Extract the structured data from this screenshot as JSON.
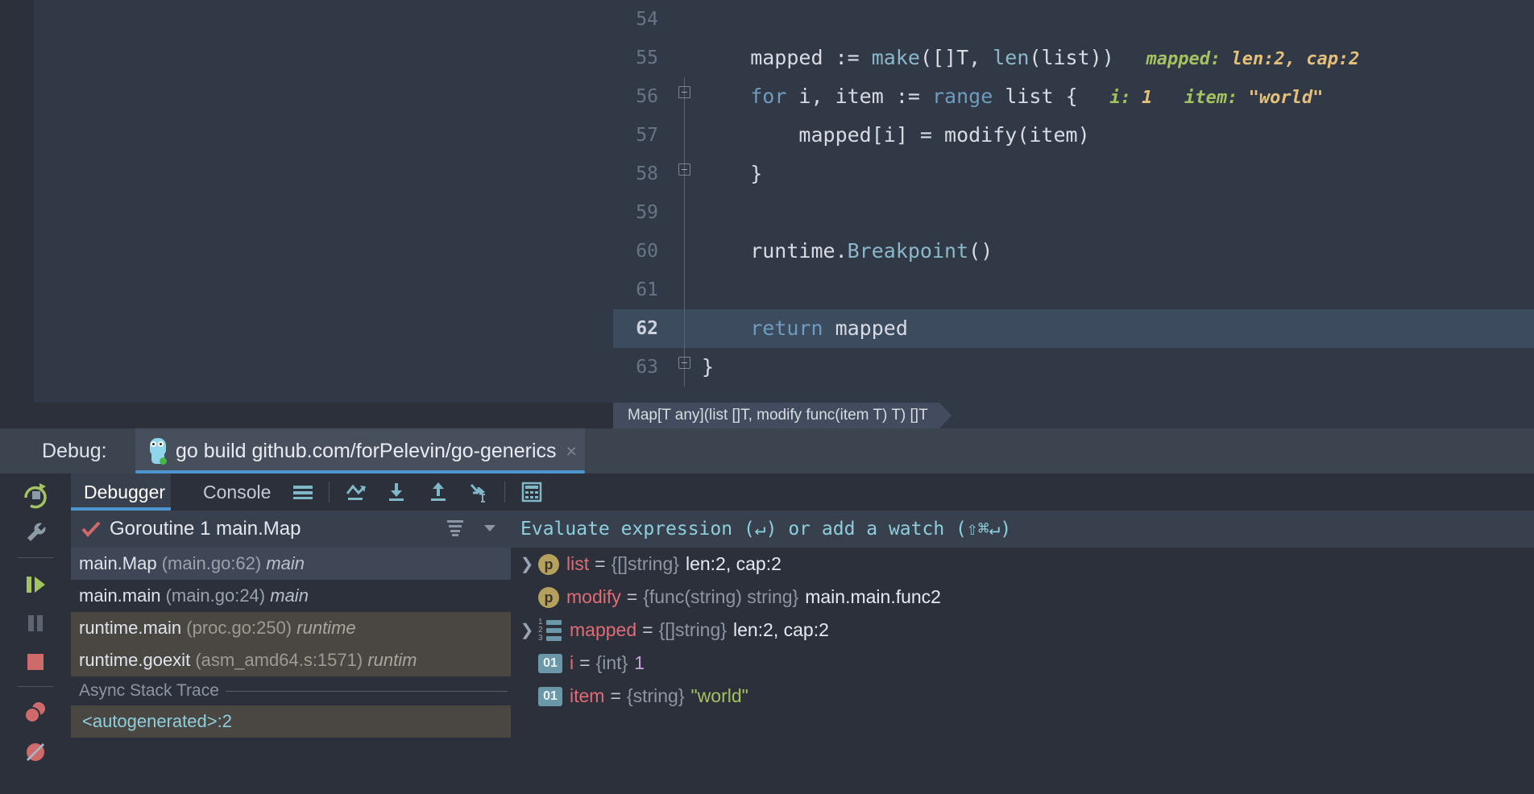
{
  "editor": {
    "lines": [
      {
        "num": "54",
        "text": "",
        "fold": "",
        "current": false,
        "hints": []
      },
      {
        "num": "55",
        "text": "    mapped := make([]T, len(list))",
        "fold": "",
        "current": false,
        "hints": [
          {
            "name": "mapped:",
            "value": "len:2, cap:2"
          }
        ]
      },
      {
        "num": "56",
        "text": "    for i, item := range list {",
        "fold": "start",
        "current": false,
        "hints": [
          {
            "name": "i:",
            "value": "1"
          },
          {
            "name": "item:",
            "value": "\"world\""
          }
        ]
      },
      {
        "num": "57",
        "text": "        mapped[i] = modify(item)",
        "fold": "line",
        "current": false,
        "hints": []
      },
      {
        "num": "58",
        "text": "    }",
        "fold": "end",
        "current": false,
        "hints": []
      },
      {
        "num": "59",
        "text": "",
        "fold": "line",
        "current": false,
        "hints": []
      },
      {
        "num": "60",
        "text": "    runtime.Breakpoint()",
        "fold": "line",
        "current": false,
        "hints": []
      },
      {
        "num": "61",
        "text": "",
        "fold": "line",
        "current": false,
        "hints": []
      },
      {
        "num": "62",
        "text": "    return mapped",
        "fold": "line",
        "current": true,
        "hints": []
      },
      {
        "num": "63",
        "text": "}",
        "fold": "end",
        "current": false,
        "hints": []
      }
    ],
    "breadcrumb": "Map[T any](list []T, modify func(item T) T) []T"
  },
  "debug_header": {
    "label": "Debug:",
    "tab_title": "go build github.com/forPelevin/go-generics",
    "close_icon": "×",
    "run_icon": "go-gopher-icon"
  },
  "gutter_tools": [
    {
      "name": "rerun-icon",
      "title": "Rerun"
    },
    {
      "name": "settings-wrench-icon",
      "title": "Settings"
    },
    {
      "name": "resume-program-icon",
      "title": "Resume Program"
    },
    {
      "name": "pause-program-icon",
      "title": "Pause Program"
    },
    {
      "name": "stop-icon",
      "title": "Stop"
    },
    {
      "name": "view-breakpoints-icon",
      "title": "View Breakpoints"
    },
    {
      "name": "mute-breakpoints-icon",
      "title": "Mute Breakpoints"
    }
  ],
  "toolbar": {
    "tabs": [
      {
        "label": "Debugger",
        "active": true
      },
      {
        "label": "Console",
        "active": false
      }
    ],
    "icons": [
      {
        "name": "layout-settings-icon",
        "title": "Layout Settings"
      },
      {
        "name": "step-over-icon",
        "title": "Step Over"
      },
      {
        "name": "step-into-icon",
        "title": "Step Into"
      },
      {
        "name": "step-out-icon",
        "title": "Step Out"
      },
      {
        "name": "run-to-cursor-icon",
        "title": "Run to Cursor"
      },
      {
        "name": "evaluate-expression-icon",
        "title": "Evaluate Expression"
      }
    ]
  },
  "frames": {
    "thread_title": "Goroutine 1 main.Map",
    "rows": [
      {
        "fn": "main.Map",
        "loc": "(main.go:62)",
        "mod": "main",
        "state": "selected"
      },
      {
        "fn": "main.main",
        "loc": "(main.go:24)",
        "mod": "main",
        "state": "normal"
      },
      {
        "fn": "runtime.main",
        "loc": "(proc.go:250)",
        "mod": "runtime",
        "state": "lib"
      },
      {
        "fn": "runtime.goexit",
        "loc": "(asm_amd64.s:1571)",
        "mod": "runtim",
        "state": "lib"
      }
    ],
    "async_label": "Async Stack Trace",
    "async_rows": [
      "<autogenerated>:2"
    ]
  },
  "variables": {
    "hint": "Evaluate expression (↵) or add a watch (⇧⌘↵)",
    "rows": [
      {
        "expandable": true,
        "badge": "p",
        "name": "list",
        "type": "{[]string}",
        "value": "len:2, cap:2",
        "value_kind": "plain"
      },
      {
        "expandable": false,
        "badge": "p",
        "name": "modify",
        "type": "{func(string) string}",
        "value": "main.main.func2",
        "value_kind": "plain"
      },
      {
        "expandable": true,
        "badge": "arr",
        "name": "mapped",
        "type": "{[]string}",
        "value": "len:2, cap:2",
        "value_kind": "plain"
      },
      {
        "expandable": false,
        "badge": "01",
        "name": "i",
        "type": "{int}",
        "value": "1",
        "value_kind": "num"
      },
      {
        "expandable": false,
        "badge": "01",
        "name": "item",
        "type": "{string}",
        "value": "\"world\"",
        "value_kind": "str"
      }
    ]
  },
  "colors": {
    "background": "#2b303b",
    "editor_bg": "#313846",
    "accent_blue": "#4e94ce",
    "current_line": "#3d4b5e",
    "string_green": "#a5c261",
    "hint_value": "#e5c07b",
    "var_name_red": "#e06c75",
    "cyan": "#8ecfdd"
  }
}
